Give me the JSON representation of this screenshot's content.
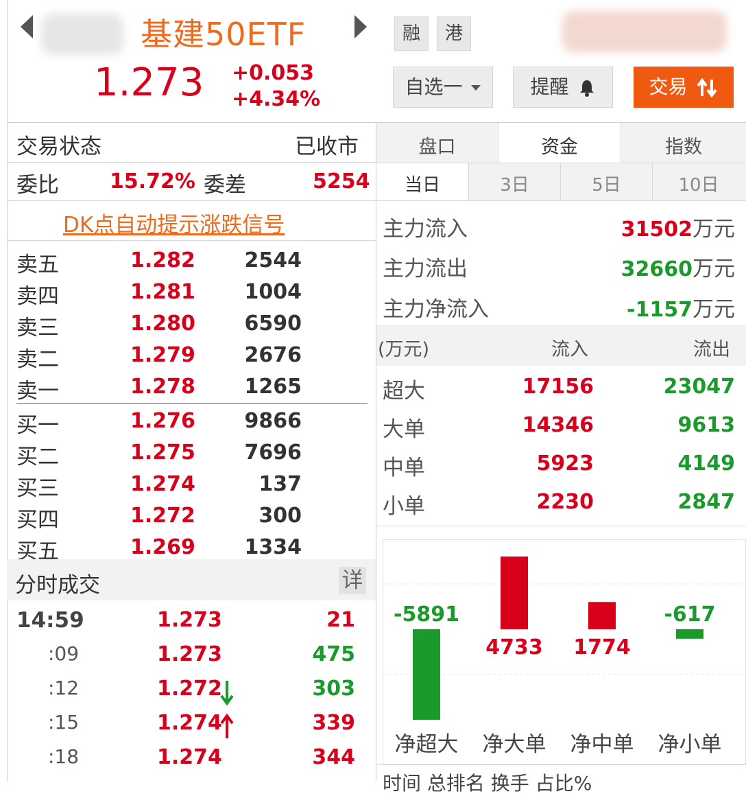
{
  "header": {
    "title": "基建50ETF",
    "price": "1.273",
    "change": "+0.053",
    "change_pct": "+4.34%",
    "tag_margin": "融",
    "tag_hk": "港",
    "watchlist_label": "自选一",
    "remind_label": "提醒",
    "trade_label": "交易"
  },
  "status": {
    "label": "交易状态",
    "value": "已收市",
    "ratio_label": "委比",
    "ratio_value": "15.72%",
    "diff_label": "委差",
    "diff_value": "5254",
    "dk_link": "DK点自动提示涨跌信号"
  },
  "orderbook": {
    "asks": [
      {
        "label": "卖五",
        "price": "1.282",
        "vol": "2544"
      },
      {
        "label": "卖四",
        "price": "1.281",
        "vol": "1004"
      },
      {
        "label": "卖三",
        "price": "1.280",
        "vol": "6590"
      },
      {
        "label": "卖二",
        "price": "1.279",
        "vol": "2676"
      },
      {
        "label": "卖一",
        "price": "1.278",
        "vol": "1265"
      }
    ],
    "bids": [
      {
        "label": "买一",
        "price": "1.276",
        "vol": "9866"
      },
      {
        "label": "买二",
        "price": "1.275",
        "vol": "7696"
      },
      {
        "label": "买三",
        "price": "1.274",
        "vol": "137"
      },
      {
        "label": "买四",
        "price": "1.272",
        "vol": "300"
      },
      {
        "label": "买五",
        "price": "1.269",
        "vol": "1334"
      }
    ]
  },
  "ticks": {
    "title": "分时成交",
    "detail_label": "详",
    "rows": [
      {
        "time": "14:59",
        "price": "1.273",
        "arrow": "",
        "vol": "21",
        "vol_color": "red"
      },
      {
        "time": ":09",
        "price": "1.273",
        "arrow": "",
        "vol": "475",
        "vol_color": "green"
      },
      {
        "time": ":12",
        "price": "1.272",
        "arrow": "down",
        "vol": "303",
        "vol_color": "green"
      },
      {
        "time": ":15",
        "price": "1.274",
        "arrow": "up",
        "vol": "339",
        "vol_color": "red"
      },
      {
        "time": ":18",
        "price": "1.274",
        "arrow": "",
        "vol": "344",
        "vol_color": "red"
      }
    ]
  },
  "tabs": [
    "盘口",
    "资金",
    "指数"
  ],
  "subtabs": [
    "当日",
    "3日",
    "5日",
    "10日"
  ],
  "flow": {
    "in_label": "主力流入",
    "in_value": "31502",
    "in_unit": "万元",
    "out_label": "主力流出",
    "out_value": "32660",
    "out_unit": "万元",
    "net_label": "主力净流入",
    "net_value": "-1157",
    "net_unit": "万元"
  },
  "flow_table": {
    "unit_label": "(万元)",
    "in_header": "流入",
    "out_header": "流出",
    "rows": [
      {
        "label": "超大",
        "in": "17156",
        "out": "23047"
      },
      {
        "label": "大单",
        "in": "14346",
        "out": "9613"
      },
      {
        "label": "中单",
        "in": "5923",
        "out": "4149"
      },
      {
        "label": "小单",
        "in": "2230",
        "out": "2847"
      }
    ]
  },
  "colors": {
    "up": "#d9001b",
    "down": "#1a9a2a",
    "accent": "#f05a10"
  },
  "chart_data": {
    "type": "bar",
    "categories": [
      "净超大",
      "净大单",
      "净中单",
      "净小单"
    ],
    "values": [
      -5891,
      4733,
      1774,
      -617
    ],
    "labels": [
      "-5891",
      "4733",
      "1774",
      "-617"
    ]
  },
  "footer_cut": "时间  总排名  换手  占比%"
}
